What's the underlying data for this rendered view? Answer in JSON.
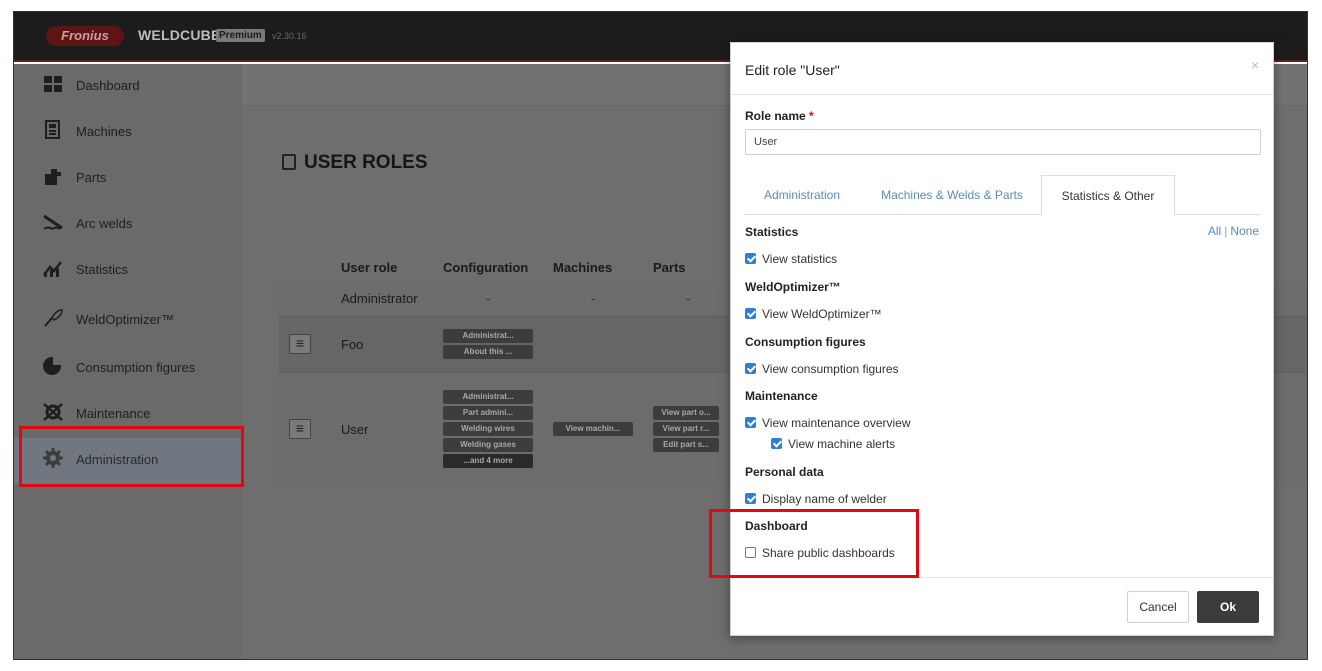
{
  "app": {
    "logo_text": "Fronius",
    "brand": "WELDCUBE",
    "edition": "Premium",
    "version": "v2.30.16"
  },
  "sidebar": {
    "items": [
      {
        "label": "Dashboard",
        "icon": "dashboard-icon"
      },
      {
        "label": "Machines",
        "icon": "machine-icon"
      },
      {
        "label": "Parts",
        "icon": "parts-icon"
      },
      {
        "label": "Arc welds",
        "icon": "arc-weld-icon"
      },
      {
        "label": "Statistics",
        "icon": "statistics-icon"
      },
      {
        "label": "WeldOptimizer™",
        "icon": "weldoptimizer-icon"
      },
      {
        "label": "Consumption figures",
        "icon": "pie-chart-icon"
      },
      {
        "label": "Maintenance",
        "icon": "maintenance-icon"
      },
      {
        "label": "Administration",
        "icon": "gear-icon",
        "active": true
      }
    ]
  },
  "page": {
    "title": "USER ROLES"
  },
  "table": {
    "headers": [
      "User role",
      "Configuration",
      "Machines",
      "Parts"
    ],
    "rows": [
      {
        "role": "Administrator",
        "configuration": "-",
        "machines": "-",
        "parts": "-"
      },
      {
        "role": "Foo",
        "configuration": [
          "Administrat...",
          "About this ..."
        ]
      },
      {
        "role": "User",
        "configuration": [
          "Administrat...",
          "Part admini...",
          "Welding wires",
          "Welding gases",
          "...and 4 more"
        ],
        "machines": [
          "View machin..."
        ],
        "parts": [
          "View part o...",
          "View part r...",
          "Edit part s..."
        ]
      }
    ]
  },
  "modal": {
    "title": "Edit role \"User\"",
    "close": "×",
    "role_name_label": "Role name",
    "required_mark": "*",
    "role_name_value": "User",
    "tabs": [
      "Administration",
      "Machines & Welds & Parts",
      "Statistics & Other"
    ],
    "all": "All",
    "separator": "|",
    "none": "None",
    "sections": {
      "statistics": {
        "title": "Statistics",
        "view": "View statistics"
      },
      "weldoptimizer": {
        "title": "WeldOptimizer™",
        "view": "View WeldOptimizer™"
      },
      "consumption": {
        "title": "Consumption figures",
        "view": "View consumption figures"
      },
      "maintenance": {
        "title": "Maintenance",
        "overview": "View maintenance overview",
        "alerts": "View machine alerts"
      },
      "personal": {
        "title": "Personal data",
        "welder": "Display name of welder"
      },
      "dashboard": {
        "title": "Dashboard",
        "share": "Share public dashboards"
      }
    },
    "cancel": "Cancel",
    "ok": "Ok"
  },
  "colors": {
    "accent_blue": "#2f7fd6",
    "highlight_red": "#e30613",
    "tab_link": "#5a8bb5"
  }
}
